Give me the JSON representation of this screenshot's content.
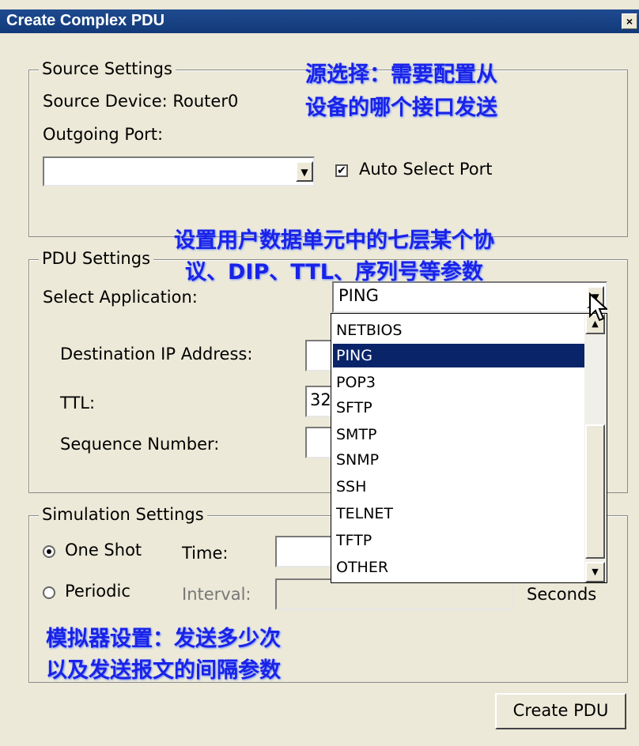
{
  "window": {
    "title": "Create Complex PDU",
    "close_label": "×"
  },
  "source_settings": {
    "legend": "Source Settings",
    "source_device": "Source Device: Router0",
    "outgoing_port_label": "Outgoing Port:",
    "outgoing_port_value": "",
    "auto_select_label": "Auto Select Port",
    "auto_select_checked": true
  },
  "pdu_settings": {
    "legend": "PDU Settings",
    "select_application_label": "Select Application:",
    "select_application_value": "PING",
    "destination_ip_label": "Destination IP Address:",
    "destination_ip_value": "",
    "ttl_label": "TTL:",
    "ttl_value": "32",
    "sequence_number_label": "Sequence Number:",
    "sequence_number_value": "",
    "application_options": [
      "NETBIOS",
      "PING",
      "POP3",
      "SFTP",
      "SMTP",
      "SNMP",
      "SSH",
      "TELNET",
      "TFTP",
      "OTHER"
    ],
    "selected_option": "PING"
  },
  "simulation_settings": {
    "legend": "Simulation Settings",
    "one_shot_label": "One Shot",
    "time_label": "Time:",
    "time_value": "",
    "periodic_label": "Periodic",
    "interval_label": "Interval:",
    "interval_value": "",
    "seconds_label": "Seconds",
    "mode": "One Shot"
  },
  "create_button_label": "Create PDU",
  "annotations": {
    "source_line1": "源选择：需要配置从",
    "source_line2": "设备的哪个接口发送",
    "pdu_line1": "设置用户数据单元中的七层某个协",
    "pdu_line2": "议、DIP、TTL、序列号等参数",
    "sim_line1": "模拟器设置：发送多少次",
    "sim_line2": "以及发送报文的间隔参数"
  },
  "colors": {
    "title_bar": "#123a7a",
    "annotation_text": "#1a22e8",
    "selection": "#0a246a",
    "dialog_bg": "#ece9d8"
  }
}
